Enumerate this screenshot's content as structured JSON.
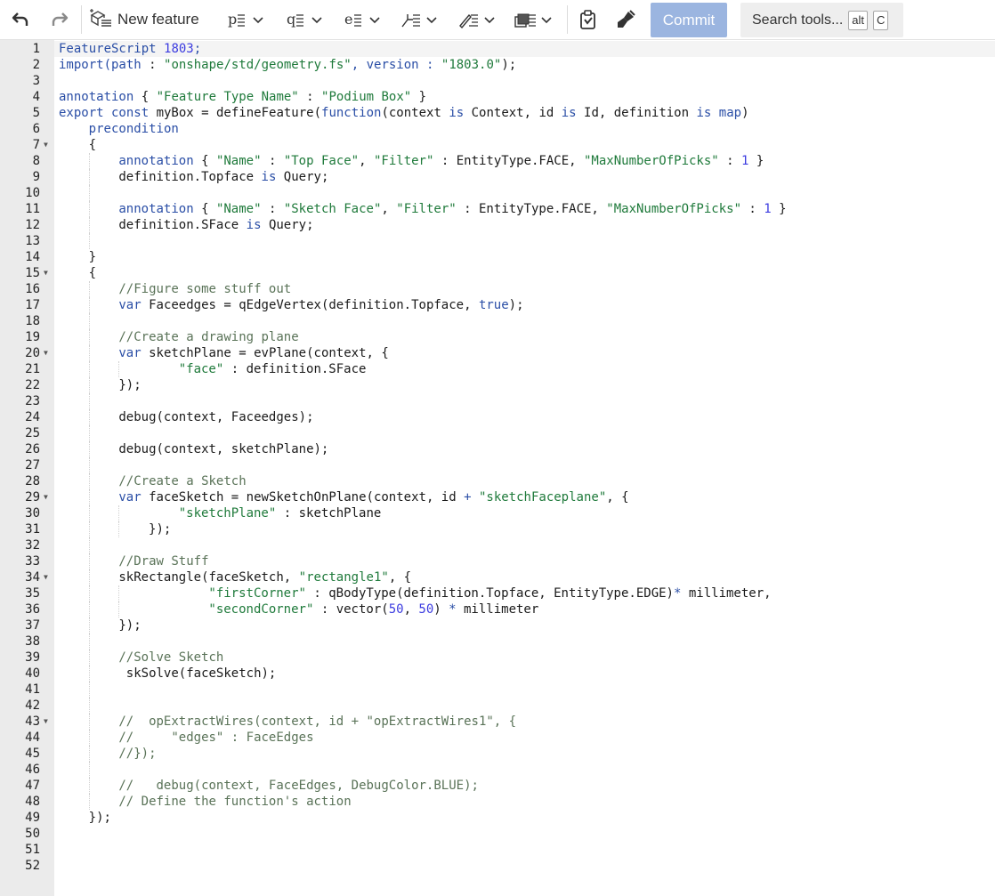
{
  "toolbar": {
    "icons": [
      "undo-icon",
      "redo-icon",
      "new-feature-icon",
      "insert-part-studio-icon",
      "insert-query-icon",
      "insert-evaluate-icon",
      "insert-operation-icon",
      "insert-sketch-icon",
      "insert-boolean-icon",
      "paste-icon",
      "format-brush-icon"
    ],
    "new_feature_label": "New feature",
    "commit_label": "Commit",
    "search_label": "Search tools...",
    "search_key1": "alt",
    "search_key2": "C"
  },
  "colors": {
    "keyword": "#2a4ea6",
    "string": "#1f7a3b",
    "comment": "#5a7358",
    "number": "#3c3ce0",
    "commit_bg": "#9bb5e0",
    "gutter_bg": "#ebebeb"
  },
  "editor": {
    "lines": [
      {
        "n": "1",
        "indent": 0,
        "fold": false,
        "tokens": [
          {
            "t": "FeatureScript ",
            "c": "k"
          },
          {
            "t": "1803",
            "c": "n"
          },
          {
            "t": ";",
            "c": "k"
          }
        ]
      },
      {
        "n": "2",
        "indent": 0,
        "fold": false,
        "tokens": [
          {
            "t": "import(path",
            "c": "k"
          },
          {
            "t": " : ",
            "c": "t"
          },
          {
            "t": "\"onshape/std/geometry.fs\"",
            "c": "s"
          },
          {
            "t": ", version : ",
            "c": "k"
          },
          {
            "t": "\"1803.0\"",
            "c": "s"
          },
          {
            "t": ");",
            "c": "t"
          }
        ]
      },
      {
        "n": "3",
        "indent": 0,
        "fold": false,
        "tokens": []
      },
      {
        "n": "4",
        "indent": 0,
        "fold": false,
        "tokens": [
          {
            "t": "annotation",
            "c": "k"
          },
          {
            "t": " { ",
            "c": "t"
          },
          {
            "t": "\"Feature Type Name\"",
            "c": "s"
          },
          {
            "t": " : ",
            "c": "t"
          },
          {
            "t": "\"Podium Box\"",
            "c": "s"
          },
          {
            "t": " }",
            "c": "t"
          }
        ]
      },
      {
        "n": "5",
        "indent": 0,
        "fold": false,
        "tokens": [
          {
            "t": "export const ",
            "c": "k"
          },
          {
            "t": "myBox = defineFeature(",
            "c": "t"
          },
          {
            "t": "function",
            "c": "k"
          },
          {
            "t": "(context ",
            "c": "t"
          },
          {
            "t": "is",
            "c": "k"
          },
          {
            "t": " Context, id ",
            "c": "t"
          },
          {
            "t": "is",
            "c": "k"
          },
          {
            "t": " Id, definition ",
            "c": "t"
          },
          {
            "t": "is",
            "c": "k"
          },
          {
            "t": " ",
            "c": "t"
          },
          {
            "t": "map",
            "c": "k"
          },
          {
            "t": ")",
            "c": "t"
          }
        ]
      },
      {
        "n": "6",
        "indent": 1,
        "fold": false,
        "tokens": [
          {
            "t": "precondition",
            "c": "k"
          }
        ]
      },
      {
        "n": "7",
        "indent": 1,
        "fold": true,
        "tokens": [
          {
            "t": "{",
            "c": "t"
          }
        ]
      },
      {
        "n": "8",
        "indent": 2,
        "fold": false,
        "tokens": [
          {
            "t": "annotation",
            "c": "k"
          },
          {
            "t": " { ",
            "c": "t"
          },
          {
            "t": "\"Name\"",
            "c": "s"
          },
          {
            "t": " : ",
            "c": "t"
          },
          {
            "t": "\"Top Face\"",
            "c": "s"
          },
          {
            "t": ", ",
            "c": "t"
          },
          {
            "t": "\"Filter\"",
            "c": "s"
          },
          {
            "t": " : EntityType.FACE, ",
            "c": "t"
          },
          {
            "t": "\"MaxNumberOfPicks\"",
            "c": "s"
          },
          {
            "t": " : ",
            "c": "t"
          },
          {
            "t": "1",
            "c": "n"
          },
          {
            "t": " }",
            "c": "t"
          }
        ]
      },
      {
        "n": "9",
        "indent": 2,
        "fold": false,
        "tokens": [
          {
            "t": "definition.Topface ",
            "c": "t"
          },
          {
            "t": "is",
            "c": "k"
          },
          {
            "t": " Query;",
            "c": "t"
          }
        ]
      },
      {
        "n": "10",
        "indent": 2,
        "fold": false,
        "tokens": []
      },
      {
        "n": "11",
        "indent": 2,
        "fold": false,
        "tokens": [
          {
            "t": "annotation",
            "c": "k"
          },
          {
            "t": " { ",
            "c": "t"
          },
          {
            "t": "\"Name\"",
            "c": "s"
          },
          {
            "t": " : ",
            "c": "t"
          },
          {
            "t": "\"Sketch Face\"",
            "c": "s"
          },
          {
            "t": ", ",
            "c": "t"
          },
          {
            "t": "\"Filter\"",
            "c": "s"
          },
          {
            "t": " : EntityType.FACE, ",
            "c": "t"
          },
          {
            "t": "\"MaxNumberOfPicks\"",
            "c": "s"
          },
          {
            "t": " : ",
            "c": "t"
          },
          {
            "t": "1",
            "c": "n"
          },
          {
            "t": " }",
            "c": "t"
          }
        ]
      },
      {
        "n": "12",
        "indent": 2,
        "fold": false,
        "tokens": [
          {
            "t": "definition.SFace ",
            "c": "t"
          },
          {
            "t": "is",
            "c": "k"
          },
          {
            "t": " Query;",
            "c": "t"
          }
        ]
      },
      {
        "n": "13",
        "indent": 2,
        "fold": false,
        "tokens": []
      },
      {
        "n": "14",
        "indent": 1,
        "fold": false,
        "tokens": [
          {
            "t": "}",
            "c": "t"
          }
        ]
      },
      {
        "n": "15",
        "indent": 1,
        "fold": true,
        "tokens": [
          {
            "t": "{",
            "c": "t"
          }
        ]
      },
      {
        "n": "16",
        "indent": 2,
        "fold": false,
        "tokens": [
          {
            "t": "//Figure some stuff out",
            "c": "c"
          }
        ]
      },
      {
        "n": "17",
        "indent": 2,
        "fold": false,
        "tokens": [
          {
            "t": "var",
            "c": "k"
          },
          {
            "t": " Faceedges = qEdgeVertex(definition.Topface, ",
            "c": "t"
          },
          {
            "t": "true",
            "c": "k"
          },
          {
            "t": ");",
            "c": "t"
          }
        ]
      },
      {
        "n": "18",
        "indent": 2,
        "fold": false,
        "tokens": []
      },
      {
        "n": "19",
        "indent": 2,
        "fold": false,
        "tokens": [
          {
            "t": "//Create a drawing plane",
            "c": "c"
          }
        ]
      },
      {
        "n": "20",
        "indent": 2,
        "fold": true,
        "tokens": [
          {
            "t": "var",
            "c": "k"
          },
          {
            "t": " sketchPlane = evPlane(context, {",
            "c": "t"
          }
        ]
      },
      {
        "n": "21",
        "indent": 4,
        "fold": false,
        "tokens": [
          {
            "t": "\"face\"",
            "c": "s"
          },
          {
            "t": " : definition.SFace",
            "c": "t"
          }
        ]
      },
      {
        "n": "22",
        "indent": 2,
        "fold": false,
        "tokens": [
          {
            "t": "});",
            "c": "t"
          }
        ]
      },
      {
        "n": "23",
        "indent": 2,
        "fold": false,
        "tokens": []
      },
      {
        "n": "24",
        "indent": 2,
        "fold": false,
        "tokens": [
          {
            "t": "debug(context, Faceedges);",
            "c": "t"
          }
        ]
      },
      {
        "n": "25",
        "indent": 2,
        "fold": false,
        "tokens": []
      },
      {
        "n": "26",
        "indent": 2,
        "fold": false,
        "tokens": [
          {
            "t": "debug(context, sketchPlane);",
            "c": "t"
          }
        ]
      },
      {
        "n": "27",
        "indent": 2,
        "fold": false,
        "tokens": []
      },
      {
        "n": "28",
        "indent": 2,
        "fold": false,
        "tokens": [
          {
            "t": "//Create a Sketch",
            "c": "c"
          }
        ]
      },
      {
        "n": "29",
        "indent": 2,
        "fold": true,
        "tokens": [
          {
            "t": "var",
            "c": "k"
          },
          {
            "t": " faceSketch = newSketchOnPlane(context, id ",
            "c": "t"
          },
          {
            "t": "+",
            "c": "k"
          },
          {
            "t": " ",
            "c": "t"
          },
          {
            "t": "\"sketchFaceplane\"",
            "c": "s"
          },
          {
            "t": ", {",
            "c": "t"
          }
        ]
      },
      {
        "n": "30",
        "indent": 4,
        "fold": false,
        "tokens": [
          {
            "t": "\"sketchPlane\"",
            "c": "s"
          },
          {
            "t": " : sketchPlane",
            "c": "t"
          }
        ]
      },
      {
        "n": "31",
        "indent": 3,
        "fold": false,
        "tokens": [
          {
            "t": "});",
            "c": "t"
          }
        ]
      },
      {
        "n": "32",
        "indent": 2,
        "fold": false,
        "tokens": []
      },
      {
        "n": "33",
        "indent": 2,
        "fold": false,
        "tokens": [
          {
            "t": "//Draw Stuff",
            "c": "c"
          }
        ]
      },
      {
        "n": "34",
        "indent": 2,
        "fold": true,
        "tokens": [
          {
            "t": "skRectangle(faceSketch, ",
            "c": "t"
          },
          {
            "t": "\"rectangle1\"",
            "c": "s"
          },
          {
            "t": ", {",
            "c": "t"
          }
        ]
      },
      {
        "n": "35",
        "indent": 5,
        "fold": false,
        "tokens": [
          {
            "t": "\"firstCorner\"",
            "c": "s"
          },
          {
            "t": " : qBodyType(definition.Topface, EntityType.EDGE)",
            "c": "t"
          },
          {
            "t": "*",
            "c": "k"
          },
          {
            "t": " millimeter,",
            "c": "t"
          }
        ]
      },
      {
        "n": "36",
        "indent": 5,
        "fold": false,
        "tokens": [
          {
            "t": "\"secondCorner\"",
            "c": "s"
          },
          {
            "t": " : vector(",
            "c": "t"
          },
          {
            "t": "50",
            "c": "n"
          },
          {
            "t": ", ",
            "c": "t"
          },
          {
            "t": "50",
            "c": "n"
          },
          {
            "t": ") ",
            "c": "t"
          },
          {
            "t": "*",
            "c": "k"
          },
          {
            "t": " millimeter",
            "c": "t"
          }
        ]
      },
      {
        "n": "37",
        "indent": 2,
        "fold": false,
        "tokens": [
          {
            "t": "});",
            "c": "t"
          }
        ]
      },
      {
        "n": "38",
        "indent": 2,
        "fold": false,
        "tokens": []
      },
      {
        "n": "39",
        "indent": 2,
        "fold": false,
        "tokens": [
          {
            "t": "//Solve Sketch",
            "c": "c"
          }
        ]
      },
      {
        "n": "40",
        "indent": 2,
        "fold": false,
        "tokens": [
          {
            "t": " skSolve(faceSketch);",
            "c": "t"
          }
        ]
      },
      {
        "n": "41",
        "indent": 2,
        "fold": false,
        "tokens": []
      },
      {
        "n": "42",
        "indent": 2,
        "fold": false,
        "tokens": []
      },
      {
        "n": "43",
        "indent": 2,
        "fold": true,
        "tokens": [
          {
            "t": "//  opExtractWires(context, id + \"opExtractWires1\", {",
            "c": "c"
          }
        ]
      },
      {
        "n": "44",
        "indent": 2,
        "fold": false,
        "tokens": [
          {
            "t": "//     \"edges\" : FaceEdges",
            "c": "c"
          }
        ]
      },
      {
        "n": "45",
        "indent": 2,
        "fold": false,
        "tokens": [
          {
            "t": "//});",
            "c": "c"
          }
        ]
      },
      {
        "n": "46",
        "indent": 2,
        "fold": false,
        "tokens": []
      },
      {
        "n": "47",
        "indent": 2,
        "fold": false,
        "tokens": [
          {
            "t": "//   debug(context, FaceEdges, DebugColor.BLUE);",
            "c": "c"
          }
        ]
      },
      {
        "n": "48",
        "indent": 2,
        "fold": false,
        "tokens": [
          {
            "t": "// Define the function's action",
            "c": "c"
          }
        ]
      },
      {
        "n": "49",
        "indent": 1,
        "fold": false,
        "tokens": [
          {
            "t": "});",
            "c": "t"
          }
        ]
      },
      {
        "n": "50",
        "indent": 0,
        "fold": false,
        "tokens": []
      },
      {
        "n": "51",
        "indent": 0,
        "fold": false,
        "tokens": []
      },
      {
        "n": "52",
        "indent": 0,
        "fold": false,
        "tokens": []
      }
    ]
  }
}
